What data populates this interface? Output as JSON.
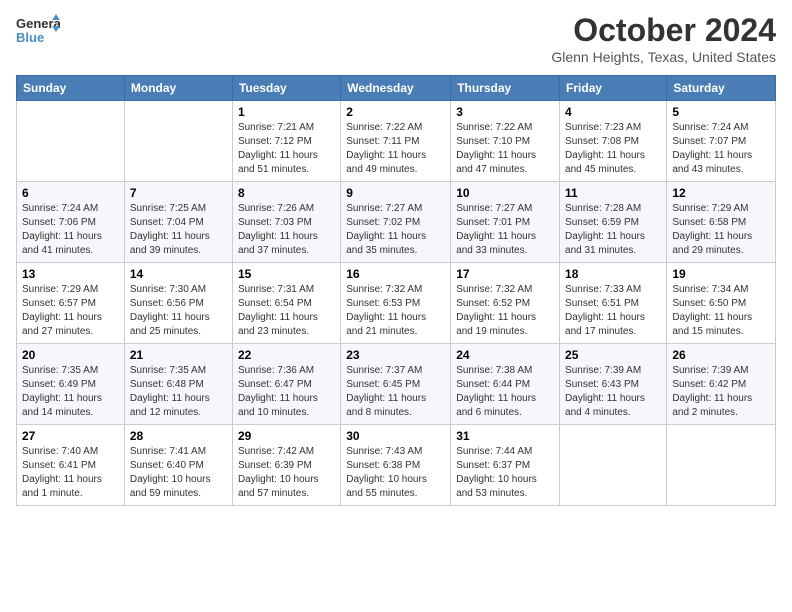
{
  "logo": {
    "line1": "General",
    "line2": "Blue"
  },
  "title": "October 2024",
  "location": "Glenn Heights, Texas, United States",
  "days_header": [
    "Sunday",
    "Monday",
    "Tuesday",
    "Wednesday",
    "Thursday",
    "Friday",
    "Saturday"
  ],
  "weeks": [
    [
      {
        "day": "",
        "sunrise": "",
        "sunset": "",
        "daylight": ""
      },
      {
        "day": "",
        "sunrise": "",
        "sunset": "",
        "daylight": ""
      },
      {
        "day": "1",
        "sunrise": "Sunrise: 7:21 AM",
        "sunset": "Sunset: 7:12 PM",
        "daylight": "Daylight: 11 hours and 51 minutes."
      },
      {
        "day": "2",
        "sunrise": "Sunrise: 7:22 AM",
        "sunset": "Sunset: 7:11 PM",
        "daylight": "Daylight: 11 hours and 49 minutes."
      },
      {
        "day": "3",
        "sunrise": "Sunrise: 7:22 AM",
        "sunset": "Sunset: 7:10 PM",
        "daylight": "Daylight: 11 hours and 47 minutes."
      },
      {
        "day": "4",
        "sunrise": "Sunrise: 7:23 AM",
        "sunset": "Sunset: 7:08 PM",
        "daylight": "Daylight: 11 hours and 45 minutes."
      },
      {
        "day": "5",
        "sunrise": "Sunrise: 7:24 AM",
        "sunset": "Sunset: 7:07 PM",
        "daylight": "Daylight: 11 hours and 43 minutes."
      }
    ],
    [
      {
        "day": "6",
        "sunrise": "Sunrise: 7:24 AM",
        "sunset": "Sunset: 7:06 PM",
        "daylight": "Daylight: 11 hours and 41 minutes."
      },
      {
        "day": "7",
        "sunrise": "Sunrise: 7:25 AM",
        "sunset": "Sunset: 7:04 PM",
        "daylight": "Daylight: 11 hours and 39 minutes."
      },
      {
        "day": "8",
        "sunrise": "Sunrise: 7:26 AM",
        "sunset": "Sunset: 7:03 PM",
        "daylight": "Daylight: 11 hours and 37 minutes."
      },
      {
        "day": "9",
        "sunrise": "Sunrise: 7:27 AM",
        "sunset": "Sunset: 7:02 PM",
        "daylight": "Daylight: 11 hours and 35 minutes."
      },
      {
        "day": "10",
        "sunrise": "Sunrise: 7:27 AM",
        "sunset": "Sunset: 7:01 PM",
        "daylight": "Daylight: 11 hours and 33 minutes."
      },
      {
        "day": "11",
        "sunrise": "Sunrise: 7:28 AM",
        "sunset": "Sunset: 6:59 PM",
        "daylight": "Daylight: 11 hours and 31 minutes."
      },
      {
        "day": "12",
        "sunrise": "Sunrise: 7:29 AM",
        "sunset": "Sunset: 6:58 PM",
        "daylight": "Daylight: 11 hours and 29 minutes."
      }
    ],
    [
      {
        "day": "13",
        "sunrise": "Sunrise: 7:29 AM",
        "sunset": "Sunset: 6:57 PM",
        "daylight": "Daylight: 11 hours and 27 minutes."
      },
      {
        "day": "14",
        "sunrise": "Sunrise: 7:30 AM",
        "sunset": "Sunset: 6:56 PM",
        "daylight": "Daylight: 11 hours and 25 minutes."
      },
      {
        "day": "15",
        "sunrise": "Sunrise: 7:31 AM",
        "sunset": "Sunset: 6:54 PM",
        "daylight": "Daylight: 11 hours and 23 minutes."
      },
      {
        "day": "16",
        "sunrise": "Sunrise: 7:32 AM",
        "sunset": "Sunset: 6:53 PM",
        "daylight": "Daylight: 11 hours and 21 minutes."
      },
      {
        "day": "17",
        "sunrise": "Sunrise: 7:32 AM",
        "sunset": "Sunset: 6:52 PM",
        "daylight": "Daylight: 11 hours and 19 minutes."
      },
      {
        "day": "18",
        "sunrise": "Sunrise: 7:33 AM",
        "sunset": "Sunset: 6:51 PM",
        "daylight": "Daylight: 11 hours and 17 minutes."
      },
      {
        "day": "19",
        "sunrise": "Sunrise: 7:34 AM",
        "sunset": "Sunset: 6:50 PM",
        "daylight": "Daylight: 11 hours and 15 minutes."
      }
    ],
    [
      {
        "day": "20",
        "sunrise": "Sunrise: 7:35 AM",
        "sunset": "Sunset: 6:49 PM",
        "daylight": "Daylight: 11 hours and 14 minutes."
      },
      {
        "day": "21",
        "sunrise": "Sunrise: 7:35 AM",
        "sunset": "Sunset: 6:48 PM",
        "daylight": "Daylight: 11 hours and 12 minutes."
      },
      {
        "day": "22",
        "sunrise": "Sunrise: 7:36 AM",
        "sunset": "Sunset: 6:47 PM",
        "daylight": "Daylight: 11 hours and 10 minutes."
      },
      {
        "day": "23",
        "sunrise": "Sunrise: 7:37 AM",
        "sunset": "Sunset: 6:45 PM",
        "daylight": "Daylight: 11 hours and 8 minutes."
      },
      {
        "day": "24",
        "sunrise": "Sunrise: 7:38 AM",
        "sunset": "Sunset: 6:44 PM",
        "daylight": "Daylight: 11 hours and 6 minutes."
      },
      {
        "day": "25",
        "sunrise": "Sunrise: 7:39 AM",
        "sunset": "Sunset: 6:43 PM",
        "daylight": "Daylight: 11 hours and 4 minutes."
      },
      {
        "day": "26",
        "sunrise": "Sunrise: 7:39 AM",
        "sunset": "Sunset: 6:42 PM",
        "daylight": "Daylight: 11 hours and 2 minutes."
      }
    ],
    [
      {
        "day": "27",
        "sunrise": "Sunrise: 7:40 AM",
        "sunset": "Sunset: 6:41 PM",
        "daylight": "Daylight: 11 hours and 1 minute."
      },
      {
        "day": "28",
        "sunrise": "Sunrise: 7:41 AM",
        "sunset": "Sunset: 6:40 PM",
        "daylight": "Daylight: 10 hours and 59 minutes."
      },
      {
        "day": "29",
        "sunrise": "Sunrise: 7:42 AM",
        "sunset": "Sunset: 6:39 PM",
        "daylight": "Daylight: 10 hours and 57 minutes."
      },
      {
        "day": "30",
        "sunrise": "Sunrise: 7:43 AM",
        "sunset": "Sunset: 6:38 PM",
        "daylight": "Daylight: 10 hours and 55 minutes."
      },
      {
        "day": "31",
        "sunrise": "Sunrise: 7:44 AM",
        "sunset": "Sunset: 6:37 PM",
        "daylight": "Daylight: 10 hours and 53 minutes."
      },
      {
        "day": "",
        "sunrise": "",
        "sunset": "",
        "daylight": ""
      },
      {
        "day": "",
        "sunrise": "",
        "sunset": "",
        "daylight": ""
      }
    ]
  ]
}
